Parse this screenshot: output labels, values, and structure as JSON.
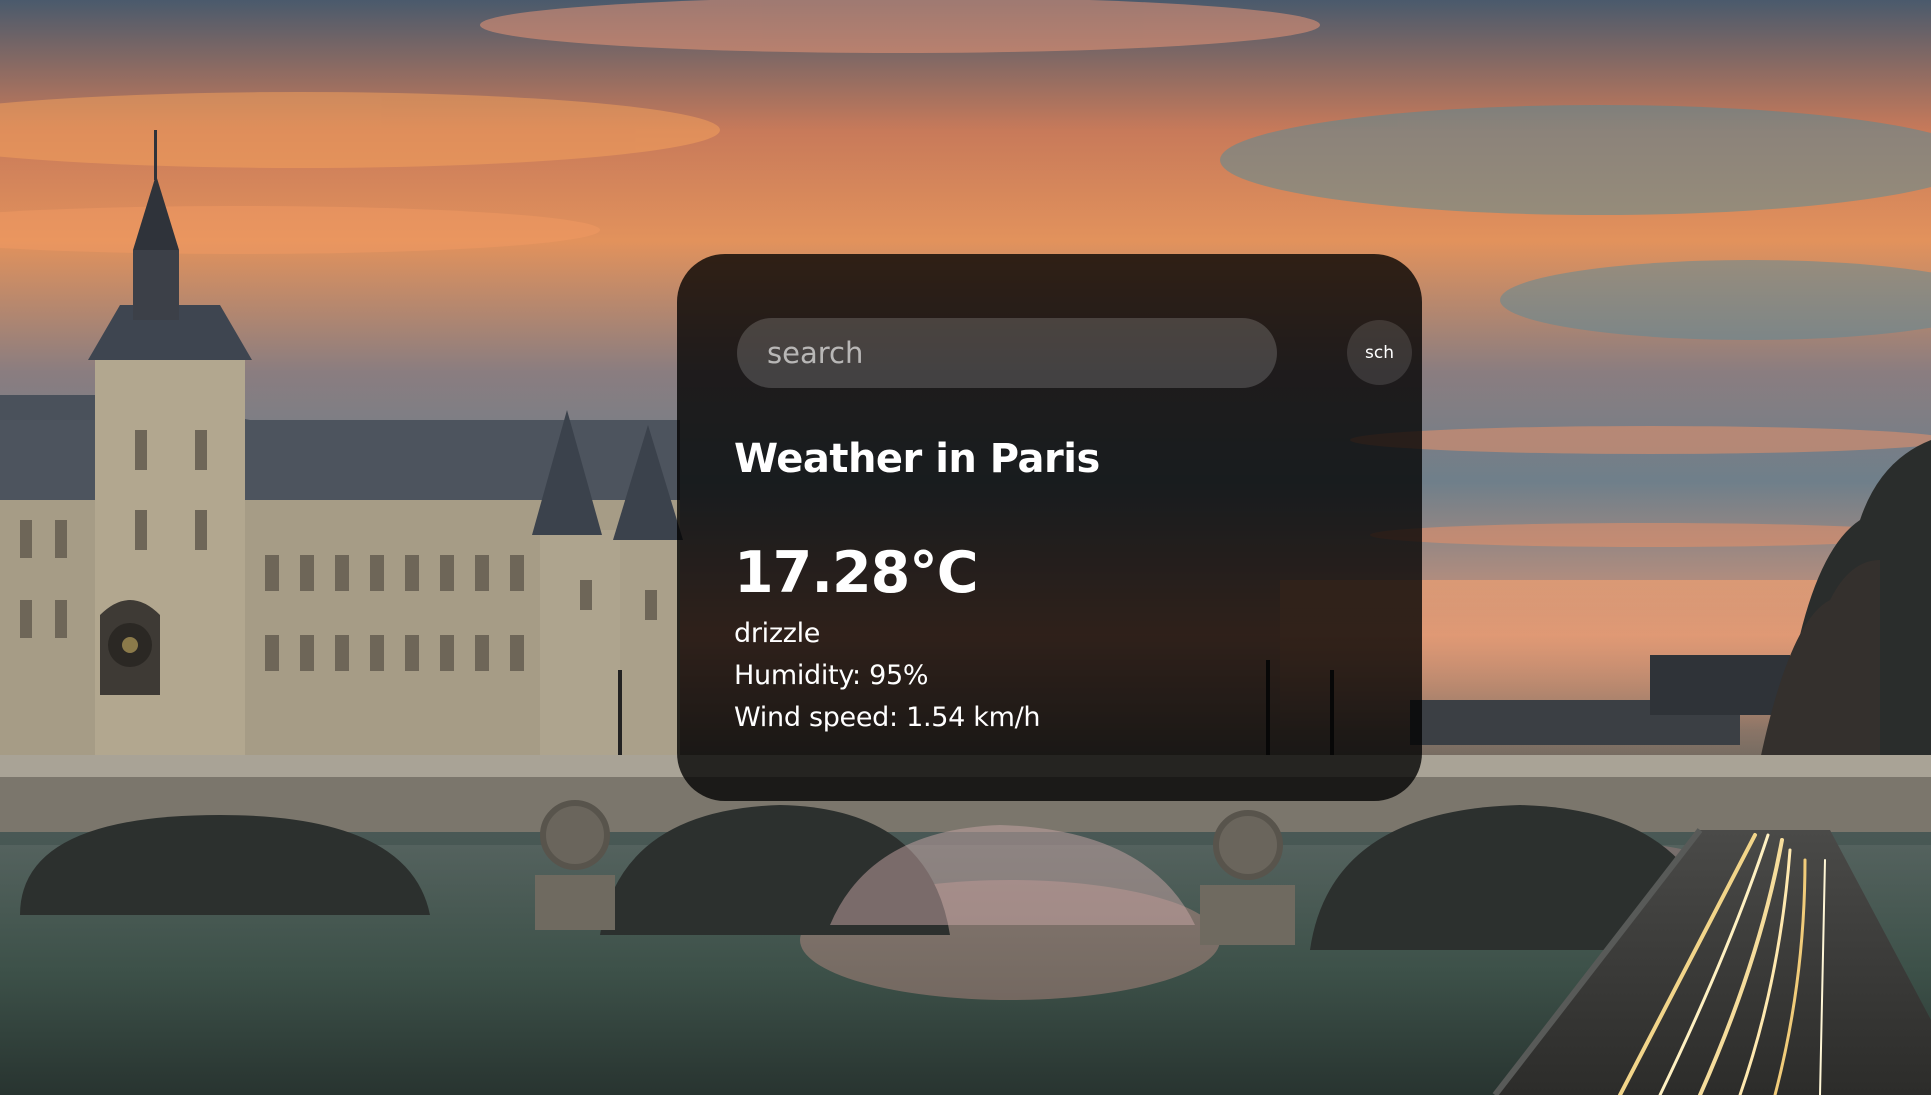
{
  "search": {
    "placeholder": "search",
    "button_label": "sch"
  },
  "weather": {
    "title": "Weather in Paris",
    "temperature": "17.28°C",
    "description": "drizzle",
    "humidity": "Humidity: 95%",
    "wind": "Wind speed: 1.54 km/h"
  },
  "background": {
    "subject": "Conciergerie and Pont au Change, Paris, at sunset"
  },
  "colors": {
    "card_background": "#000000",
    "text": "#ffffff"
  }
}
